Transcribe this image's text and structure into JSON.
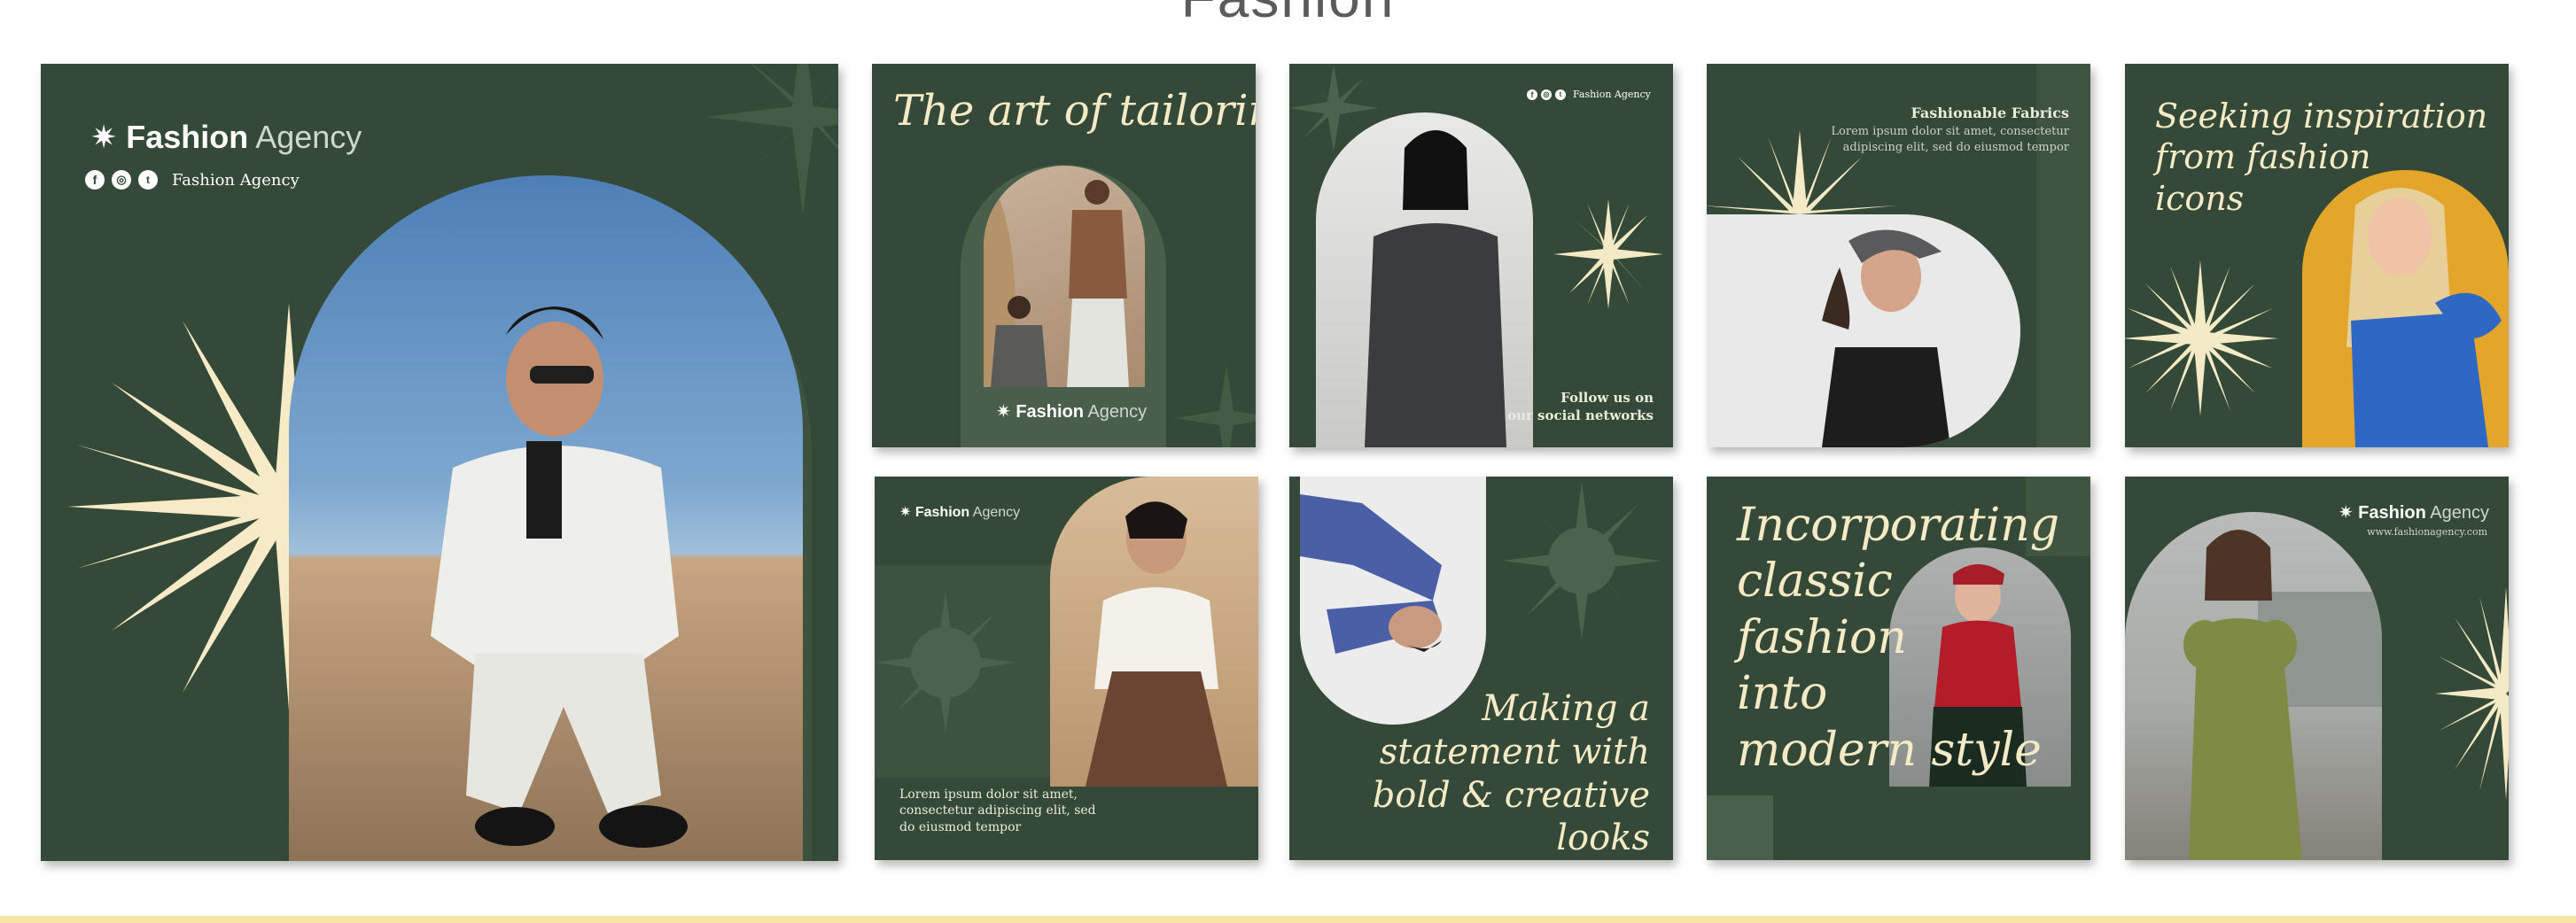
{
  "page": {
    "title": "Fashion"
  },
  "brand": {
    "strong": "Fashion",
    "thin": "Agency",
    "handle": "Fashion Agency",
    "website": "www.fashionagency.com"
  },
  "posts": {
    "p1": {
      "brand_strong": "Fashion",
      "brand_thin": "Agency",
      "handle": "Fashion Agency"
    },
    "p2": {
      "headline": "The art of tailoring",
      "brand_strong": "Fashion",
      "brand_thin": "Agency"
    },
    "p3": {
      "handle": "Fashion Agency",
      "cta_line1": "Follow us on",
      "cta_line2": "our social networks"
    },
    "p4": {
      "title": "Fashionable Fabrics",
      "body_line1": "Lorem ipsum dolor sit amet, consectetur",
      "body_line2": "adipiscing elit, sed do eiusmod tempor"
    },
    "p5": {
      "line1": "Seeking inspiration",
      "line2": "from fashion",
      "line3": "icons"
    },
    "p6": {
      "brand_strong": "Fashion",
      "brand_thin": "Agency",
      "body_line1": "Lorem ipsum dolor sit amet,",
      "body_line2": "consectetur adipiscing elit, sed",
      "body_line3": "do eiusmod tempor"
    },
    "p7": {
      "line1": "Making a",
      "line2": "statement with",
      "line3": "bold & creative looks"
    },
    "p8": {
      "line1": "Incorporating",
      "line2": "classic",
      "line3": "fashion",
      "line4": "into",
      "line5": "modern style"
    },
    "p9": {
      "brand_strong": "Fashion",
      "brand_thin": "Agency",
      "website": "www.fashionagency.com"
    }
  },
  "icons": [
    "facebook-icon",
    "instagram-icon",
    "twitter-icon",
    "starburst-icon"
  ],
  "colors": {
    "panel": "#354938",
    "cream": "#f4ebc6",
    "accent_yellow": "#e3a62b",
    "bottom_bar": "#f5e6a8"
  }
}
